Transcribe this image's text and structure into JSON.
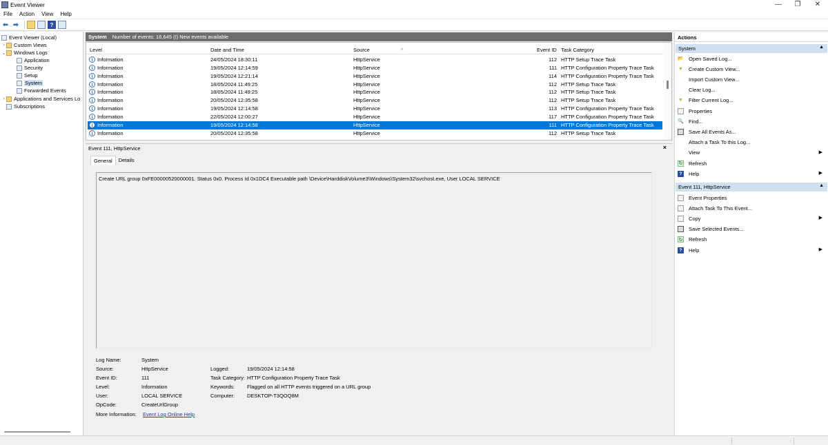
{
  "window": {
    "title": "Event Viewer",
    "minimize": "—",
    "maximize": "❐",
    "close": "✕"
  },
  "menu": [
    "File",
    "Action",
    "View",
    "Help"
  ],
  "tree": {
    "root": "Event Viewer (Local)",
    "custom_views": "Custom Views",
    "windows_logs": "Windows Logs",
    "logs": [
      "Application",
      "Security",
      "Setup",
      "System",
      "Forwarded Events"
    ],
    "apps_services": "Applications and Services Lo",
    "subscriptions": "Subscriptions"
  },
  "center": {
    "log_name": "System",
    "status": "Number of events: 16,645 (!) New events available",
    "columns": {
      "level": "Level",
      "date": "Date and Time",
      "source": "Source",
      "event_id": "Event ID",
      "task": "Task Category"
    },
    "rows": [
      {
        "level": "Information",
        "date": "24/05/2024 18:30:11",
        "source": "HttpService",
        "id": "112",
        "task": "HTTP Setup Trace Task"
      },
      {
        "level": "Information",
        "date": "19/05/2024 12:14:59",
        "source": "HttpService",
        "id": "111",
        "task": "HTTP Configuration Property Trace Task"
      },
      {
        "level": "Information",
        "date": "19/05/2024 12:21:14",
        "source": "HttpService",
        "id": "114",
        "task": "HTTP Configuration Property Trace Task"
      },
      {
        "level": "Information",
        "date": "18/05/2024 11:49:25",
        "source": "HttpService",
        "id": "112",
        "task": "HTTP Setup Trace Task"
      },
      {
        "level": "Information",
        "date": "18/05/2024 11:49:25",
        "source": "HttpService",
        "id": "112",
        "task": "HTTP Setup Trace Task"
      },
      {
        "level": "Information",
        "date": "20/05/2024 12:35:58",
        "source": "HttpService",
        "id": "112",
        "task": "HTTP Setup Trace Task"
      },
      {
        "level": "Information",
        "date": "19/05/2024 12:14:58",
        "source": "HttpService",
        "id": "113",
        "task": "HTTP Configuration Property Trace Task"
      },
      {
        "level": "Information",
        "date": "22/05/2024 12:00:27",
        "source": "HttpService",
        "id": "117",
        "task": "HTTP Configuration Property Trace Task"
      },
      {
        "level": "Information",
        "date": "19/05/2024 12:14:58",
        "source": "HttpService",
        "id": "111",
        "task": "HTTP Configuration Property Trace Task"
      },
      {
        "level": "Information",
        "date": "20/05/2024 12:35:58",
        "source": "HttpService",
        "id": "112",
        "task": "HTTP Setup Trace Task"
      }
    ],
    "selected_row": 8
  },
  "detail": {
    "header": "Event 111, HttpService",
    "close": "×",
    "tabs": [
      "General",
      "Details"
    ],
    "description": "Create URL group 0xFE00000520000001. Status 0x0. Process Id 0x1DC4 Executable path \\Device\\HarddiskVolume3\\Windows\\System32\\svchost.exe, User LOCAL SERVICE",
    "labels": {
      "log_name": "Log Name:",
      "source": "Source:",
      "event_id": "Event ID:",
      "level": "Level:",
      "user": "User:",
      "opcode": "OpCode:",
      "more_info": "More Information:",
      "logged": "Logged:",
      "task_category": "Task Category:",
      "keywords": "Keywords:",
      "computer": "Computer:"
    },
    "values": {
      "log_name": "System",
      "source": "HttpService",
      "event_id": "111",
      "level": "Information",
      "user": "LOCAL SERVICE",
      "opcode": "CreateUrlGroup",
      "more_info": "Event Log Online Help",
      "logged": "19/05/2024 12:14:58",
      "task_category": "HTTP Configuration Property Trace Task",
      "keywords": "Flagged on all HTTP events triggered on a URL group",
      "computer": "DESKTOP-T3QOQ8M"
    }
  },
  "actions": {
    "title": "Actions",
    "section1": "System",
    "items1": [
      "Open Saved Log...",
      "Create Custom View...",
      "Import Custom View...",
      "Clear Log...",
      "Filter Current Log...",
      "Properties",
      "Find...",
      "Save All Events As...",
      "Attach a Task To this Log...",
      "View",
      "Refresh",
      "Help"
    ],
    "section2": "Event 111, HttpService",
    "items2": [
      "Event Properties",
      "Attach Task To This Event...",
      "Copy",
      "Save Selected Events...",
      "Refresh",
      "Help"
    ]
  }
}
